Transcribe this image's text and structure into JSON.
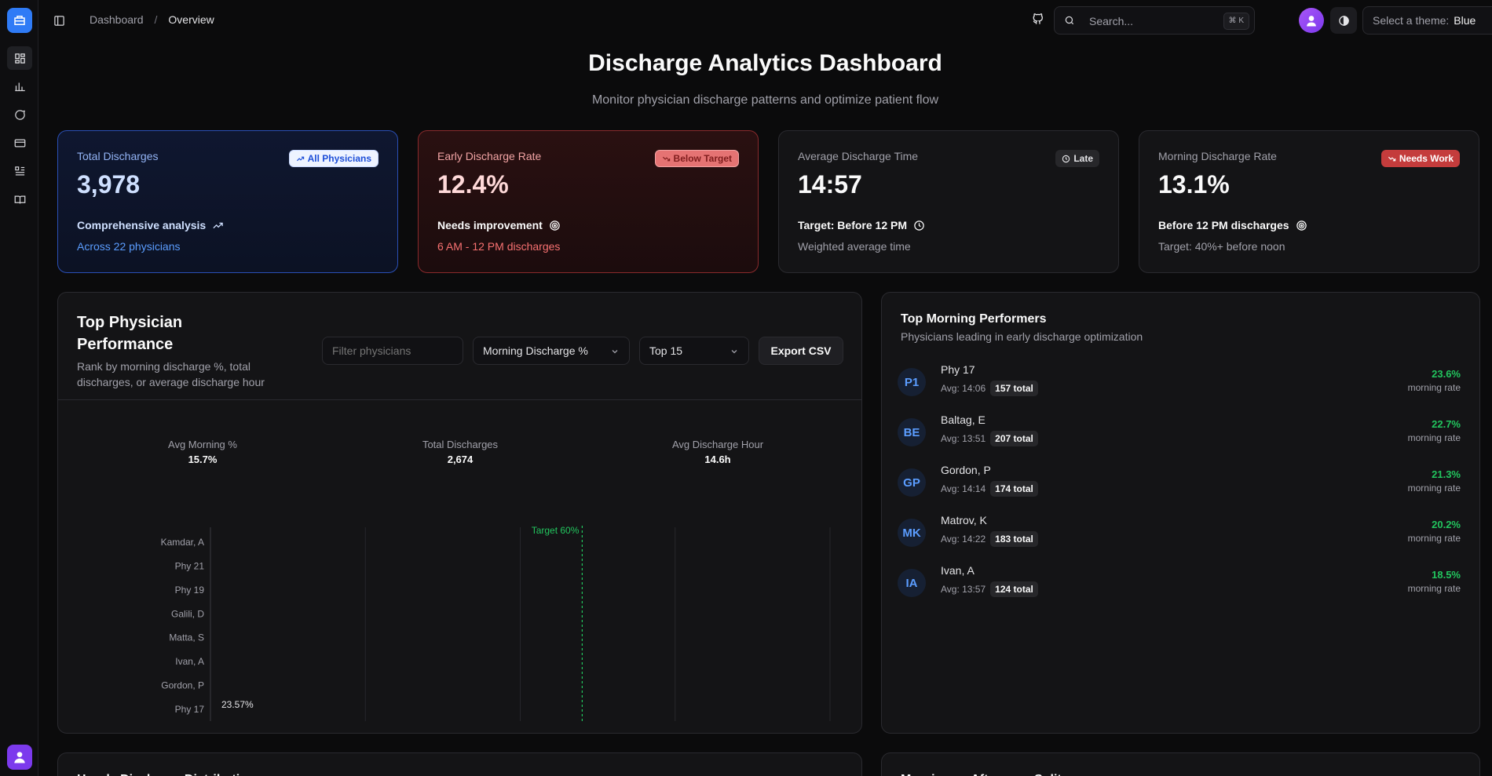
{
  "breadcrumb": {
    "root": "Dashboard",
    "sep": "/",
    "current": "Overview"
  },
  "search": {
    "placeholder": "Search...",
    "shortcut": "⌘ K"
  },
  "theme": {
    "label": "Select a theme:",
    "value": "Blue"
  },
  "header": {
    "title": "Discharge Analytics Dashboard",
    "subtitle": "Monitor physician discharge patterns and optimize patient flow"
  },
  "stats": [
    {
      "label": "Total Discharges",
      "value": "3,978",
      "badge": "All Physicians",
      "line1": "Comprehensive analysis",
      "line2": "Across 22 physicians"
    },
    {
      "label": "Early Discharge Rate",
      "value": "12.4%",
      "badge": "Below Target",
      "line1": "Needs improvement",
      "line2": "6 AM - 12 PM discharges"
    },
    {
      "label": "Average Discharge Time",
      "value": "14:57",
      "badge": "Late",
      "line1": "Target: Before 12 PM",
      "line2": "Weighted average time"
    },
    {
      "label": "Morning Discharge Rate",
      "value": "13.1%",
      "badge": "Needs Work",
      "line1": "Before 12 PM discharges",
      "line2": "Target: 40%+ before noon"
    }
  ],
  "performance": {
    "title_line1": "Top Physician",
    "title_line2": "Performance",
    "subtitle_line1": "Rank by morning discharge %, total",
    "subtitle_line2": "discharges, or average discharge hour",
    "filter_placeholder": "Filter physicians",
    "sort_value": "Morning Discharge %",
    "limit_value": "Top 15",
    "export_label": "Export CSV",
    "metrics": [
      {
        "label": "Avg Morning %",
        "value": "15.7%"
      },
      {
        "label": "Total Discharges",
        "value": "2,674"
      },
      {
        "label": "Avg Discharge Hour",
        "value": "14.6h"
      }
    ]
  },
  "chart_data": {
    "type": "bar",
    "orientation": "horizontal",
    "categories": [
      "Kamdar, A",
      "Phy 21",
      "Phy 19",
      "Galili, D",
      "Matta, S",
      "Ivan, A",
      "Gordon, P",
      "Phy 17"
    ],
    "values": [
      null,
      null,
      null,
      null,
      null,
      null,
      null,
      23.57
    ],
    "value_labels": [
      "",
      "",
      "",
      "",
      "",
      "",
      "",
      "23.57%"
    ],
    "xlim": [
      0,
      100
    ],
    "xticks": [
      "0",
      "25",
      "50",
      "75",
      "100"
    ],
    "target": {
      "value": 60,
      "label": "Target 60%"
    },
    "grid": true,
    "colors": {
      "target": "#22c55e",
      "grid": "#26262b"
    }
  },
  "top_morning": {
    "title": "Top Morning Performers",
    "subtitle": "Physicians leading in early discharge optimization",
    "rate_label": "morning rate",
    "items": [
      {
        "initials": "P1",
        "name": "Phy 17",
        "avg": "Avg: 14:06",
        "total": "157 total",
        "rate": "23.6%"
      },
      {
        "initials": "BE",
        "name": "Baltag, E",
        "avg": "Avg: 13:51",
        "total": "207 total",
        "rate": "22.7%"
      },
      {
        "initials": "GP",
        "name": "Gordon, P",
        "avg": "Avg: 14:14",
        "total": "174 total",
        "rate": "21.3%"
      },
      {
        "initials": "MK",
        "name": "Matrov, K",
        "avg": "Avg: 14:22",
        "total": "183 total",
        "rate": "20.2%"
      },
      {
        "initials": "IA",
        "name": "Ivan, A",
        "avg": "Avg: 13:57",
        "total": "124 total",
        "rate": "18.5%"
      }
    ]
  },
  "bottom": {
    "left_title": "Hourly Discharge Distribution",
    "right_title": "Morning vs Afternoon Split"
  },
  "colors": {
    "accent": "#2f7bf6",
    "success": "#22c55e",
    "danger": "#c43c3c"
  }
}
